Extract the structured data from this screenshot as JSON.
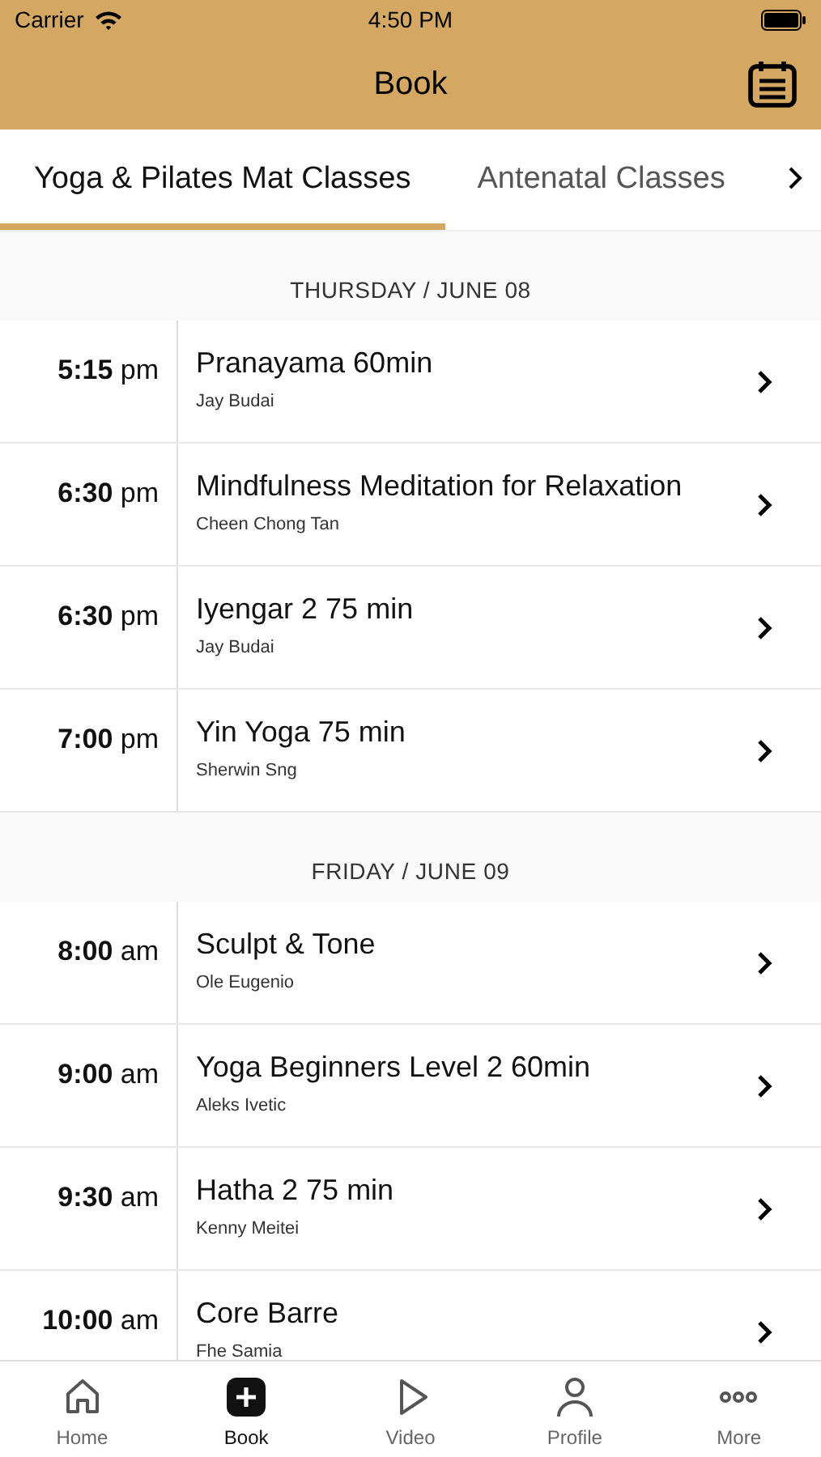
{
  "status_bar": {
    "carrier": "Carrier",
    "time": "4:50 PM"
  },
  "nav": {
    "title": "Book"
  },
  "tabs": [
    {
      "label": "Yoga & Pilates Mat Classes",
      "selected": true
    },
    {
      "label": "Antenatal Classes",
      "selected": false
    }
  ],
  "sections": [
    {
      "header": "THURSDAY / JUNE 08",
      "classes": [
        {
          "time": "5:15",
          "period": "pm",
          "title": "Pranayama 60min",
          "instructor": "Jay Budai"
        },
        {
          "time": "6:30",
          "period": "pm",
          "title": "Mindfulness Meditation for Relaxation",
          "instructor": "Cheen Chong Tan"
        },
        {
          "time": "6:30",
          "period": "pm",
          "title": "Iyengar 2 75 min",
          "instructor": "Jay Budai"
        },
        {
          "time": "7:00",
          "period": "pm",
          "title": "Yin Yoga 75 min",
          "instructor": "Sherwin Sng"
        }
      ]
    },
    {
      "header": "FRIDAY / JUNE 09",
      "classes": [
        {
          "time": "8:00",
          "period": "am",
          "title": "Sculpt & Tone",
          "instructor": "Ole Eugenio"
        },
        {
          "time": "9:00",
          "period": "am",
          "title": "Yoga Beginners Level 2 60min",
          "instructor": "Aleks Ivetic"
        },
        {
          "time": "9:30",
          "period": "am",
          "title": "Hatha 2 75 min",
          "instructor": "Kenny Meitei"
        },
        {
          "time": "10:00",
          "period": "am",
          "title": "Core Barre",
          "instructor": "Fhe Samia"
        }
      ]
    }
  ],
  "tab_bar": [
    {
      "kind": "home",
      "label": "Home",
      "selected": false
    },
    {
      "kind": "book",
      "label": "Book",
      "selected": true
    },
    {
      "kind": "video",
      "label": "Video",
      "selected": false
    },
    {
      "kind": "profile",
      "label": "Profile",
      "selected": false
    },
    {
      "kind": "more",
      "label": "More",
      "selected": false
    }
  ]
}
